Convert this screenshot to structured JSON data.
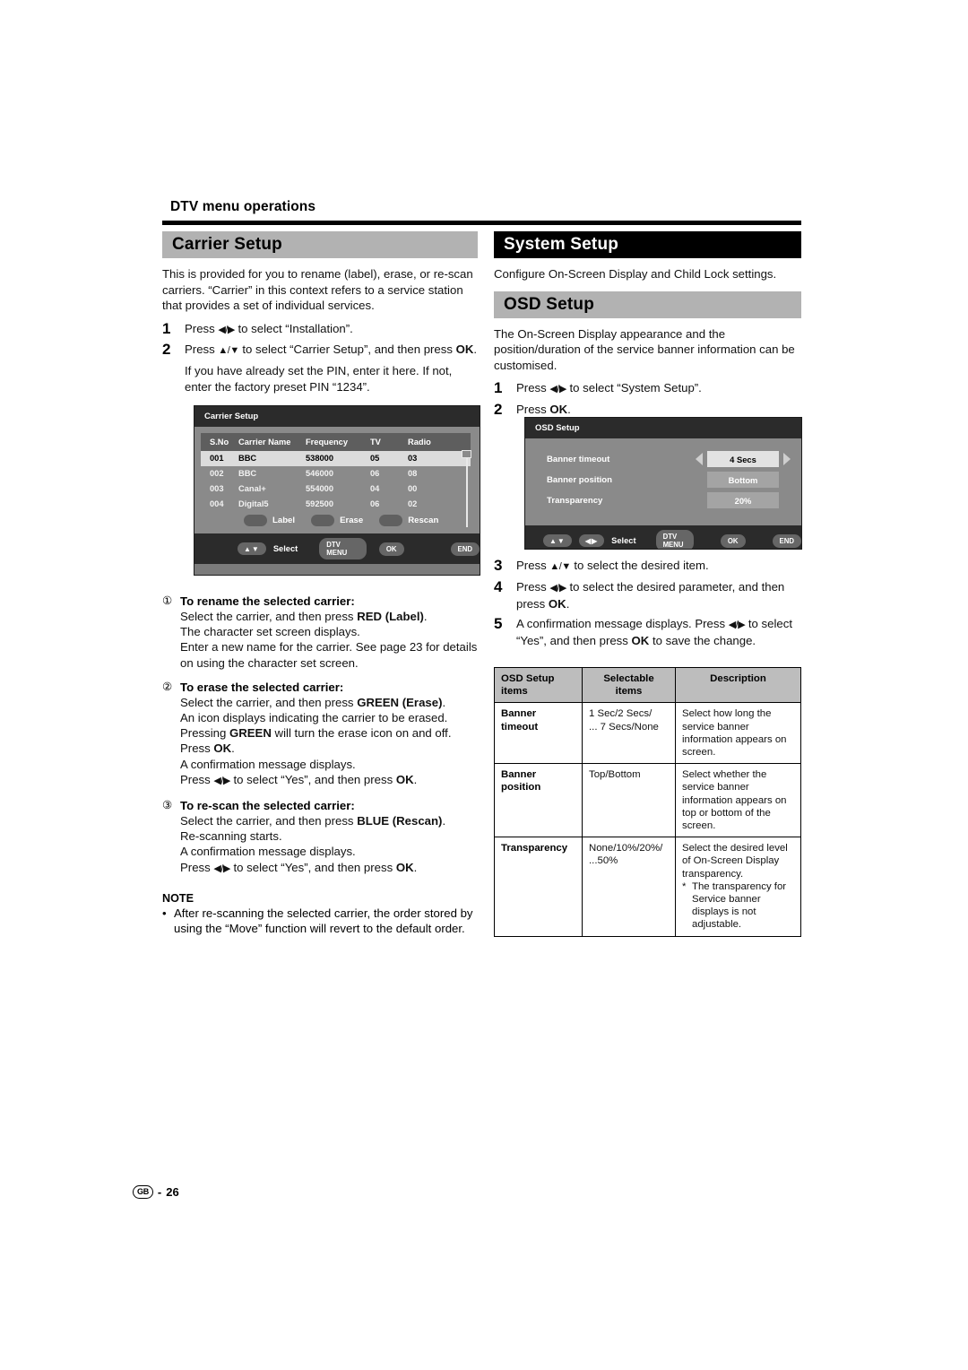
{
  "header": {
    "section_title": "DTV menu operations"
  },
  "left": {
    "heading": "Carrier Setup",
    "intro": "This is provided for you to rename (label), erase, or re-scan carriers. “Carrier” in this context refers to a service station that provides a set of individual services.",
    "steps": [
      {
        "num": "1",
        "text_pre": "Press ",
        "arrows": "◀/▶",
        "text_post": " to select “Installation”."
      },
      {
        "num": "2",
        "text_pre": "Press ",
        "arrows": "▲/▼",
        "text_post": " to select “Carrier Setup”, and then press OK."
      }
    ],
    "step2_note": "If you have already set the PIN, enter it here. If not, enter the factory preset PIN “1234”.",
    "items": [
      {
        "marker": "①",
        "title": "To rename the selected carrier:",
        "lines": [
          "Select the carrier, and then press RED (Label).",
          "The character set screen displays.",
          "Enter a new name for the carrier. See page 23 for details on using the character set screen."
        ]
      },
      {
        "marker": "②",
        "title": "To erase the selected carrier:",
        "lines": [
          "Select the carrier, and then press GREEN (Erase).",
          "An icon displays indicating the carrier to be erased.",
          "Pressing GREEN will turn the erase icon on and off.",
          "Press OK.",
          "A confirmation message displays.",
          "Press ◀/▶ to select “Yes”, and then press OK."
        ]
      },
      {
        "marker": "③",
        "title": "To re-scan the selected carrier:",
        "lines": [
          "Select the carrier, and then press BLUE (Rescan).",
          "Re-scanning starts.",
          "A confirmation message displays.",
          "Press ◀/▶ to select “Yes”, and then press OK."
        ]
      }
    ],
    "note_title": "NOTE",
    "note_bullet": "•",
    "note_text": "After re-scanning the selected carrier, the order stored by using the “Move” function will revert to the default order."
  },
  "carrier_screen": {
    "title": "Carrier Setup",
    "columns": [
      "S.No",
      "Carrier Name",
      "Frequency",
      "TV",
      "Radio"
    ],
    "rows": [
      {
        "sno": "001",
        "name": "BBC",
        "freq": "538000",
        "tv": "05",
        "radio": "03",
        "selected": true
      },
      {
        "sno": "002",
        "name": "BBC",
        "freq": "546000",
        "tv": "06",
        "radio": "08",
        "selected": false
      },
      {
        "sno": "003",
        "name": "Canal+",
        "freq": "554000",
        "tv": "04",
        "radio": "00",
        "selected": false
      },
      {
        "sno": "004",
        "name": "Digital5",
        "freq": "592500",
        "tv": "06",
        "radio": "02",
        "selected": false
      }
    ],
    "color_buttons": [
      "Label",
      "Erase",
      "Rescan"
    ],
    "footer": {
      "updown": "▲▼",
      "select": "Select",
      "dtv_menu": "DTV MENU",
      "ok": "OK",
      "end": "END"
    }
  },
  "right": {
    "heading": "System Setup",
    "intro": "Configure On-Screen Display and Child Lock settings.",
    "sub_heading": "OSD Setup",
    "sub_intro": "The On-Screen Display appearance and the position/duration of the service banner information can be customised.",
    "steps": [
      {
        "num": "1",
        "text_pre": "Press ",
        "arrows": "◀/▶",
        "text_post": " to select “System Setup”."
      },
      {
        "num": "2",
        "text_pre": "Press OK.",
        "arrows": "",
        "text_post": ""
      },
      {
        "num": "3",
        "text_pre": "Press ",
        "arrows": "▲/▼",
        "text_post": " to select the desired item."
      },
      {
        "num": "4",
        "text_pre": "Press ",
        "arrows": "◀/▶",
        "text_post": " to select the desired parameter, and then press OK."
      },
      {
        "num": "5",
        "text_pre": "A confirmation message displays. Press ",
        "arrows": "◀/▶",
        "text_post": " to select “Yes”, and then press OK to save the change."
      }
    ]
  },
  "osd_screen": {
    "title": "OSD Setup",
    "rows": [
      {
        "label": "Banner timeout",
        "value": "4 Secs",
        "active": true
      },
      {
        "label": "Banner position",
        "value": "Bottom",
        "active": false
      },
      {
        "label": "Transparency",
        "value": "20%",
        "active": false
      }
    ],
    "footer": {
      "updown": "▲▼",
      "leftright": "◀▶",
      "select": "Select",
      "dtv_menu": "DTV MENU",
      "ok": "OK",
      "end": "END"
    }
  },
  "ref_table": {
    "headers": [
      "OSD Setup items",
      "Selectable items",
      "Description"
    ],
    "rows": [
      {
        "item": "Banner timeout",
        "selectable": "1 Sec/2 Secs/\n... 7 Secs/None",
        "description": "Select how long the service banner information appears on screen.",
        "star": ""
      },
      {
        "item": "Banner position",
        "selectable": "Top/Bottom",
        "description": "Select whether the service banner information appears on top or bottom of the screen.",
        "star": ""
      },
      {
        "item": "Transparency",
        "selectable": "None/10%/20%/\n...50%",
        "description": "Select the desired level of On-Screen Display transparency.",
        "star": "The transparency for Service banner displays is not adjustable."
      }
    ]
  },
  "footer": {
    "region": "GB",
    "dash": "-",
    "page": "26"
  },
  "colors": {
    "heading_gray": "#b2b2b2",
    "heading_black": "#000000",
    "osd_body": "#8a8a8a",
    "osd_titlebar": "#2b2b2b",
    "osd_selected_row": "#dcdcdc"
  }
}
